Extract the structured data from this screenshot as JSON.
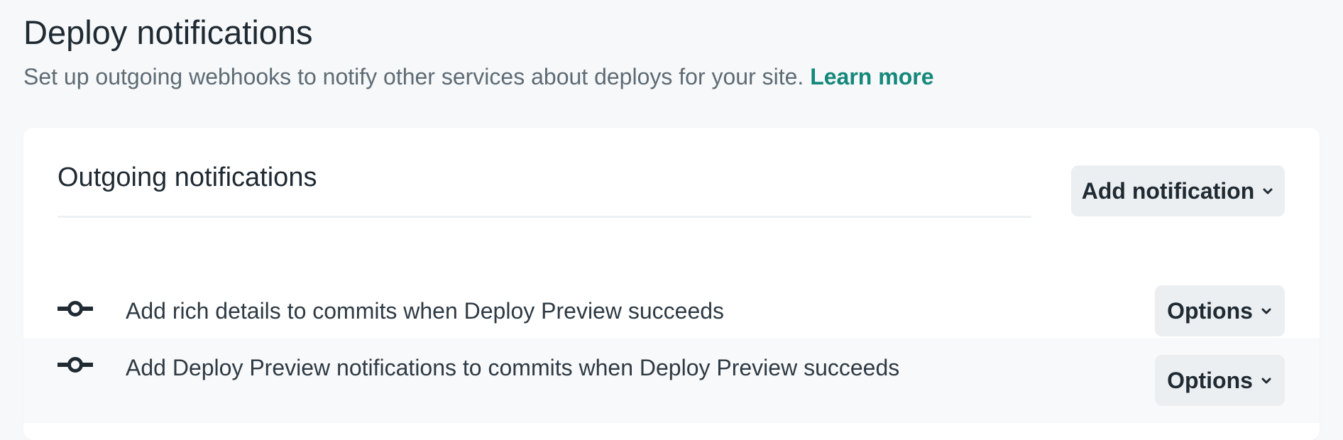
{
  "header": {
    "title": "Deploy notifications",
    "subtitle": "Set up outgoing webhooks to notify other services about deploys for your site.",
    "learn_more": "Learn more"
  },
  "card": {
    "title": "Outgoing notifications",
    "add_button": "Add notification"
  },
  "notifications": [
    {
      "label": "Add rich details to commits when Deploy Preview succeeds",
      "icon": "git-commit-icon",
      "options_label": "Options"
    },
    {
      "label": "Add Deploy Preview notifications to commits when Deploy Preview succeeds",
      "icon": "git-commit-icon",
      "options_label": "Options"
    }
  ],
  "colors": {
    "accent_link": "#15887b",
    "text_primary": "#1f2a33",
    "text_muted": "#5e6b75",
    "button_bg": "#eceff1",
    "page_bg": "#f6f8f9"
  }
}
